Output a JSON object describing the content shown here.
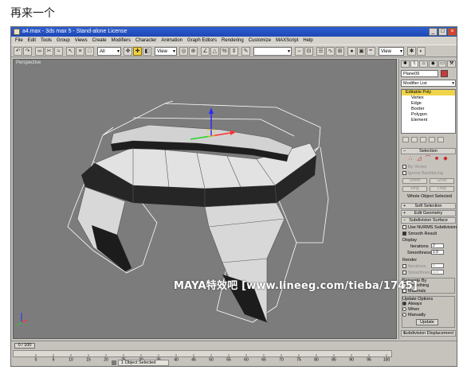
{
  "caption": "再来一个",
  "window": {
    "title": "a4.max - 3ds max 5 - Stand-alone License",
    "controls": [
      "_",
      "□",
      "×"
    ]
  },
  "menu": [
    "File",
    "Edit",
    "Tools",
    "Group",
    "Views",
    "Create",
    "Modifiers",
    "Character",
    "Animation",
    "Graph Editors",
    "Rendering",
    "Customize",
    "MAXScript",
    "Help"
  ],
  "toolbar": {
    "selection_filter": "All",
    "coord_system": "View",
    "render_type": "View"
  },
  "viewport": {
    "label": "Perspective",
    "watermark": "MAYA特效吧 [www.lineeg.com/tieba/1745]",
    "colors": {
      "background": "#7c7c7c",
      "faces": "#e2e2e2",
      "dark_faces": "#262626",
      "wire": "#ffffff"
    }
  },
  "command_panel": {
    "object_name": "Plane09",
    "modifier_list": "Modifier List",
    "stack": {
      "root": "Editable Poly",
      "children": [
        "Vertex",
        "Edge",
        "Border",
        "Polygon",
        "Element"
      ]
    },
    "selection": {
      "title": "Selection",
      "by_vertex": "By Vertex",
      "ignore_backfacing": "Ignore Backfacing",
      "shrink": "Shrink",
      "grow": "Grow",
      "ring": "Ring",
      "loop": "Loop",
      "status": "Whole Object Selected"
    },
    "soft_selection": "Soft Selection",
    "edit_geometry": "Edit Geometry",
    "subdivision": {
      "title": "Subdivision Surface",
      "use_nurms": "Use NURMS Subdivision",
      "smooth_result": "Smooth Result",
      "display_label": "Display",
      "iterations_label": "Iterations",
      "iterations_value": "2",
      "smoothness_label": "Smoothness",
      "smoothness_value": "1.0",
      "render_label": "Render",
      "render_iterations_value": "0",
      "render_smoothness_value": "1.0",
      "separate_by": "Separate By",
      "smoothing_groups": "Smoothing",
      "materials": "Materials",
      "update_options": "Update Options",
      "always": "Always",
      "when_rendering": "When",
      "manually": "Manually",
      "update_button": "Update"
    },
    "subdivision_displacement": "Subdivision Displacement"
  },
  "status": {
    "frame_counter": "0 / 100",
    "selection_text": "1 Object Selected",
    "ticks": [
      "0",
      "5",
      "10",
      "15",
      "20",
      "25",
      "30",
      "35",
      "40",
      "45",
      "50",
      "55",
      "60",
      "65",
      "70",
      "75",
      "80",
      "85",
      "90",
      "95",
      "100"
    ]
  }
}
